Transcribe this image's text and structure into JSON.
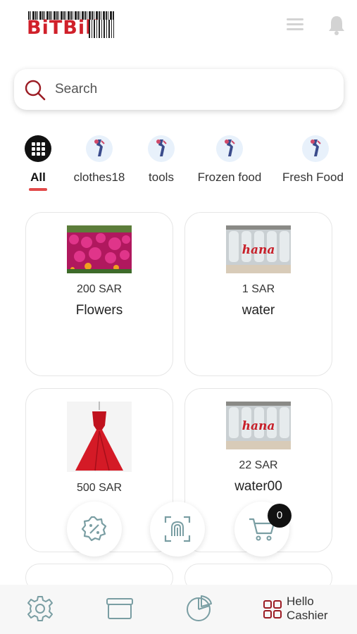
{
  "header": {
    "logo_text": "BiTBill",
    "menu_icon": "hamburger-menu-icon",
    "bell_icon": "notification-bell-icon"
  },
  "search": {
    "placeholder": "Search"
  },
  "categories": [
    {
      "label": "All",
      "icon": "grid-icon",
      "active": true
    },
    {
      "label": "clothes18",
      "icon": "category-illustration-icon"
    },
    {
      "label": "tools",
      "icon": "category-illustration-icon"
    },
    {
      "label": "Frozen food",
      "icon": "category-illustration-icon"
    },
    {
      "label": "Fresh Food",
      "icon": "category-illustration-icon"
    }
  ],
  "products": [
    {
      "price": "200 SAR",
      "name": "Flowers",
      "image": "flowers-photo"
    },
    {
      "price": "1 SAR",
      "name": "water",
      "image": "water-bottles-photo"
    },
    {
      "price": "500 SAR",
      "name": "",
      "image": "red-dress-photo"
    },
    {
      "price": "22 SAR",
      "name": "water00",
      "image": "water-bottles-photo"
    }
  ],
  "floating_actions": {
    "discount_icon": "discount-percent-icon",
    "scan_icon": "fingerprint-scan-icon",
    "cart_icon": "cart-icon",
    "cart_count": "0"
  },
  "bottom_nav": {
    "settings_icon": "settings-gear-icon",
    "box_icon": "archive-box-icon",
    "chart_icon": "pie-chart-icon",
    "cashier_line1": "Hello",
    "cashier_line2": "Cashier"
  },
  "colors": {
    "brand_red": "#d0202a",
    "accent_teal": "#7a9ea3",
    "underline_red": "#e24a4a"
  }
}
